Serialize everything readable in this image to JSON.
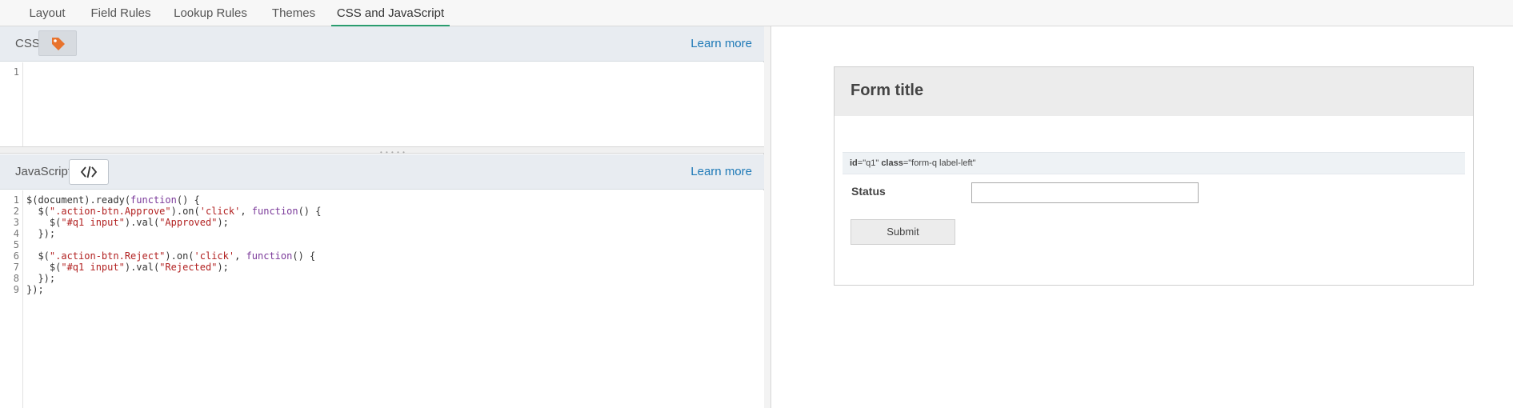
{
  "tabs": [
    {
      "label": "Layout"
    },
    {
      "label": "Field Rules"
    },
    {
      "label": "Lookup Rules"
    },
    {
      "label": "Themes"
    },
    {
      "label": "CSS and JavaScript",
      "active": true
    }
  ],
  "css_section": {
    "label": "CSS",
    "learn_more": "Learn more",
    "line_numbers": [
      "1"
    ]
  },
  "js_section": {
    "label": "JavaScript",
    "learn_more": "Learn more",
    "line_numbers": [
      "1",
      "2",
      "3",
      "4",
      "5",
      "6",
      "7",
      "8",
      "9"
    ],
    "code_lines": [
      "$(document).ready(function() {",
      "  $(\".action-btn.Approve\").on('click', function() {",
      "    $(\"#q1 input\").val(\"Approved\");",
      "  });",
      "",
      "  $(\".action-btn.Reject\").on('click', function() {",
      "    $(\"#q1 input\").val(\"Rejected\");",
      "  });",
      "});"
    ]
  },
  "preview": {
    "form_title": "Form title",
    "question_attr": {
      "id_key": "id",
      "id_val": "=\"q1\"",
      "class_key": "class",
      "class_val": "=\"form-q label-left\""
    },
    "question_label": "Status",
    "question_value": "",
    "submit_label": "Submit"
  },
  "colors": {
    "accent": "#2a9d6f",
    "link": "#1f7ab7",
    "tag_icon": "#e8732d"
  },
  "icons": {
    "css_button": "tag-icon",
    "js_button": "code-icon"
  }
}
